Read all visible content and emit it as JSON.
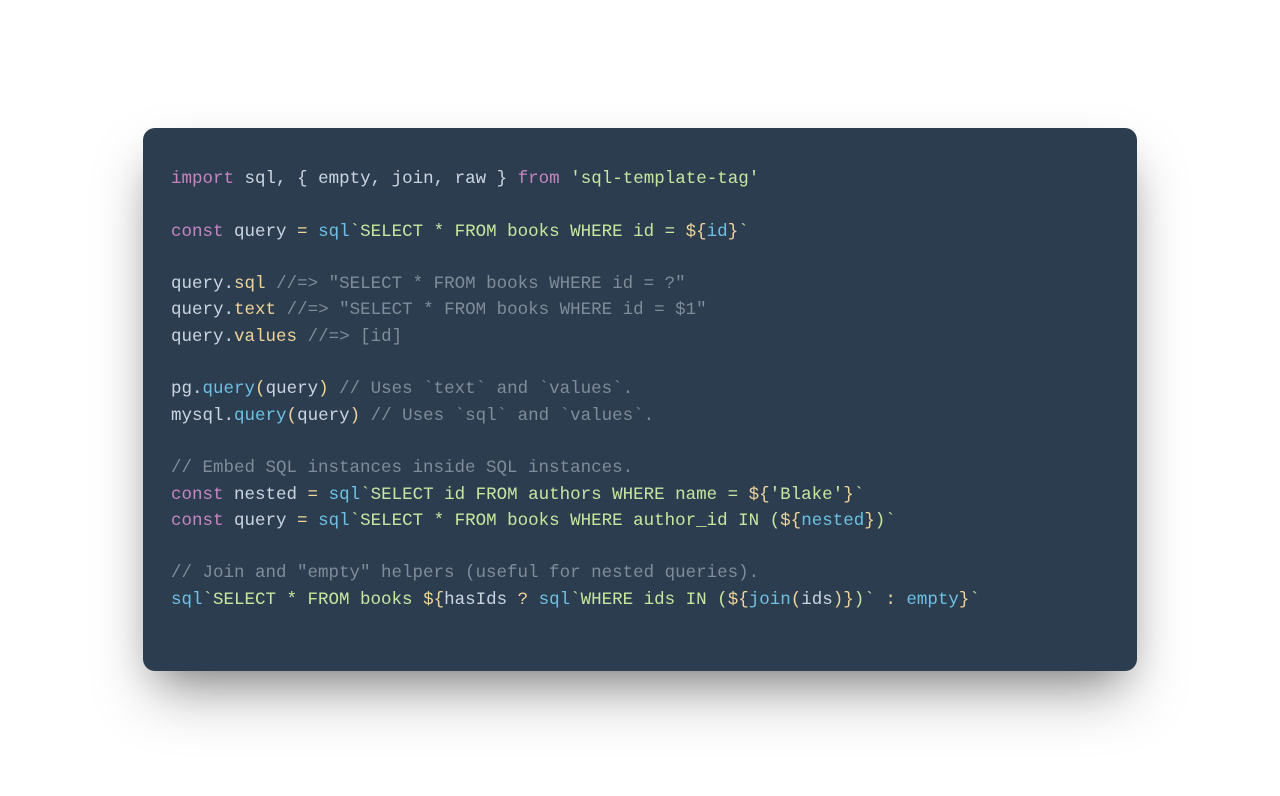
{
  "code": {
    "line1": {
      "kw1": "import",
      "sql": "sql",
      "comma1": ", ",
      "brace1": "{ ",
      "empty": "empty",
      "comma2": ", ",
      "join": "join",
      "comma3": ", ",
      "raw": "raw",
      "brace2": " } ",
      "kw2": "from",
      "sp": " ",
      "str": "'sql-template-tag'"
    },
    "line2": "",
    "line3": {
      "kw": "const",
      "sp": " ",
      "name": "query",
      "eq": " = ",
      "fn": "sql",
      "bt1": "`",
      "sql": "SELECT * FROM books WHERE id = ",
      "d1": "${",
      "var": "id",
      "d2": "}",
      "bt2": "`"
    },
    "line4": "",
    "line5": {
      "obj": "query",
      "dot": ".",
      "prop": "sql",
      "sp": " ",
      "cm": "//=> \"SELECT * FROM books WHERE id = ?\""
    },
    "line6": {
      "obj": "query",
      "dot": ".",
      "prop": "text",
      "sp": " ",
      "cm": "//=> \"SELECT * FROM books WHERE id = $1\""
    },
    "line7": {
      "obj": "query",
      "dot": ".",
      "prop": "values",
      "sp": " ",
      "cm": "//=> [id]"
    },
    "line8": "",
    "line9": {
      "obj": "pg",
      "dot": ".",
      "fn": "query",
      "lp": "(",
      "arg": "query",
      "rp": ")",
      "sp": " ",
      "cm": "// Uses `text` and `values`."
    },
    "line10": {
      "obj": "mysql",
      "dot": ".",
      "fn": "query",
      "lp": "(",
      "arg": "query",
      "rp": ")",
      "sp": " ",
      "cm": "// Uses `sql` and `values`."
    },
    "line11": "",
    "line12": {
      "cm": "// Embed SQL instances inside SQL instances."
    },
    "line13": {
      "kw": "const",
      "sp": " ",
      "name": "nested",
      "eq": " = ",
      "fn": "sql",
      "bt1": "`",
      "sql": "SELECT id FROM authors WHERE name = ",
      "d1": "${",
      "str": "'Blake'",
      "d2": "}",
      "bt2": "`"
    },
    "line14": {
      "kw": "const",
      "sp": " ",
      "name": "query",
      "eq": " = ",
      "fn": "sql",
      "bt1": "`",
      "sql1": "SELECT * FROM books WHERE author_id IN (",
      "d1": "${",
      "var": "nested",
      "d2": "}",
      "sql2": ")",
      "bt2": "`"
    },
    "line15": "",
    "line16": {
      "cm": "// Join and \"empty\" helpers (useful for nested queries)."
    },
    "line17": {
      "fn": "sql",
      "bt1": "`",
      "sql1": "SELECT * FROM books ",
      "d1": "${",
      "cond": "hasIds",
      "tern1": " ? ",
      "fn2": "sql",
      "bt2": "`",
      "sql2": "WHERE ids IN (",
      "d2": "${",
      "joinfn": "join",
      "lp": "(",
      "arg": "ids",
      "rp": ")",
      "d3": "}",
      "sql3": ")",
      "bt3": "`",
      "tern2": " : ",
      "empty": "empty",
      "d4": "}",
      "bt4": "`"
    }
  }
}
